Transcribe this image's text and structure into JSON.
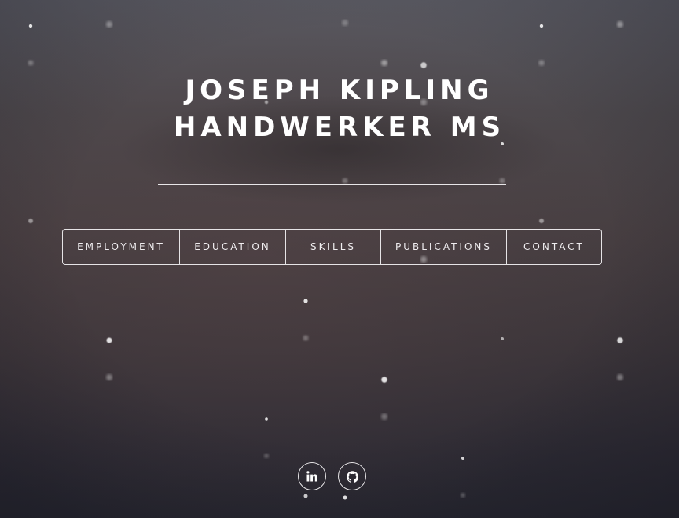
{
  "header": {
    "name_line1": "JOSEPH KIPLING",
    "name_line2": "HANDWERKER MS"
  },
  "nav": {
    "items": [
      {
        "label": "EMPLOYMENT"
      },
      {
        "label": "EDUCATION"
      },
      {
        "label": "SKILLS"
      },
      {
        "label": "PUBLICATIONS"
      },
      {
        "label": "CONTACT"
      }
    ]
  },
  "social": {
    "links": [
      {
        "icon": "linkedin-icon"
      },
      {
        "icon": "github-icon"
      }
    ]
  },
  "colors": {
    "text": "#ffffff",
    "lines": "#e8e6e8",
    "background_top": "#5a5a62",
    "background_bottom": "#26262f"
  }
}
